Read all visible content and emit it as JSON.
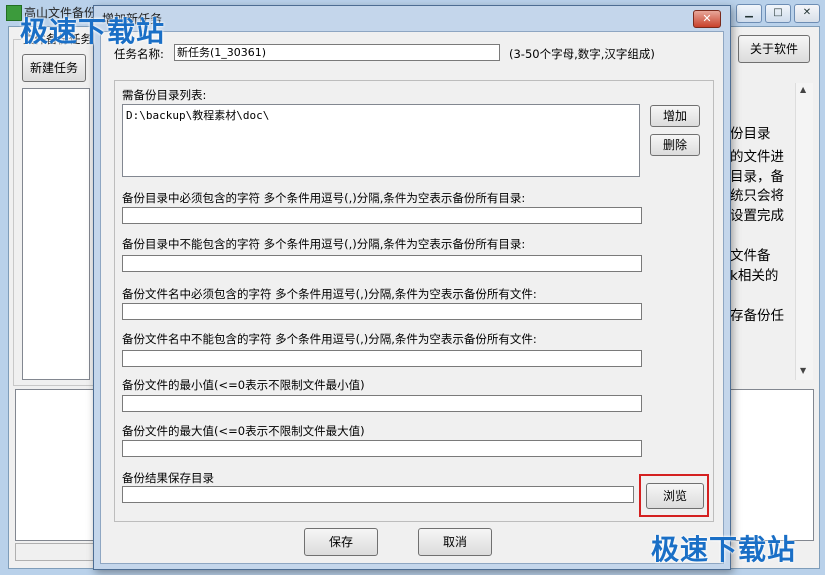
{
  "main": {
    "title": "高山文件备份",
    "group_label": "文件备份任务",
    "new_task_button": "新建任务",
    "about_button": "关于软件",
    "min_icon": "minimize-icon",
    "max_icon": "maximize-icon",
    "close_icon": "close-icon",
    "side_text": [
      "份目录",
      "的文件进",
      "目录，备",
      "统只会将",
      "设置完成",
      "文件备",
      "k相关的",
      "存备份任"
    ]
  },
  "dialog": {
    "title": "增加新任务",
    "task_name_label": "任务名称:",
    "task_name_value": "新任务(1_30361)",
    "task_name_hint": "(3-50个字母,数字,汉字组成)",
    "dir_list_label": "需备份目录列表:",
    "dir_list_items": [
      "D:\\backup\\教程素材\\doc\\"
    ],
    "add_button": "增加",
    "delete_button": "删除",
    "filters": [
      {
        "label": "备份目录中必须包含的字符  多个条件用逗号(,)分隔,条件为空表示备份所有目录:",
        "value": ""
      },
      {
        "label": "备份目录中不能包含的字符  多个条件用逗号(,)分隔,条件为空表示备份所有目录:",
        "value": ""
      },
      {
        "label": "备份文件名中必须包含的字符  多个条件用逗号(,)分隔,条件为空表示备份所有文件:",
        "value": ""
      },
      {
        "label": "备份文件名中不能包含的字符  多个条件用逗号(,)分隔,条件为空表示备份所有文件:",
        "value": ""
      },
      {
        "label": "备份文件的最小值(<=0表示不限制文件最小值)",
        "value": ""
      },
      {
        "label": "备份文件的最大值(<=0表示不限制文件最大值)",
        "value": ""
      }
    ],
    "result_dir_label": "备份结果保存目录",
    "result_dir_value": "",
    "browse_button": "浏览",
    "save_button": "保存",
    "cancel_button": "取消",
    "highlight_color": "#d42020"
  },
  "watermark": {
    "text": "极速下载站",
    "brand_color": "#1a6fc6"
  }
}
